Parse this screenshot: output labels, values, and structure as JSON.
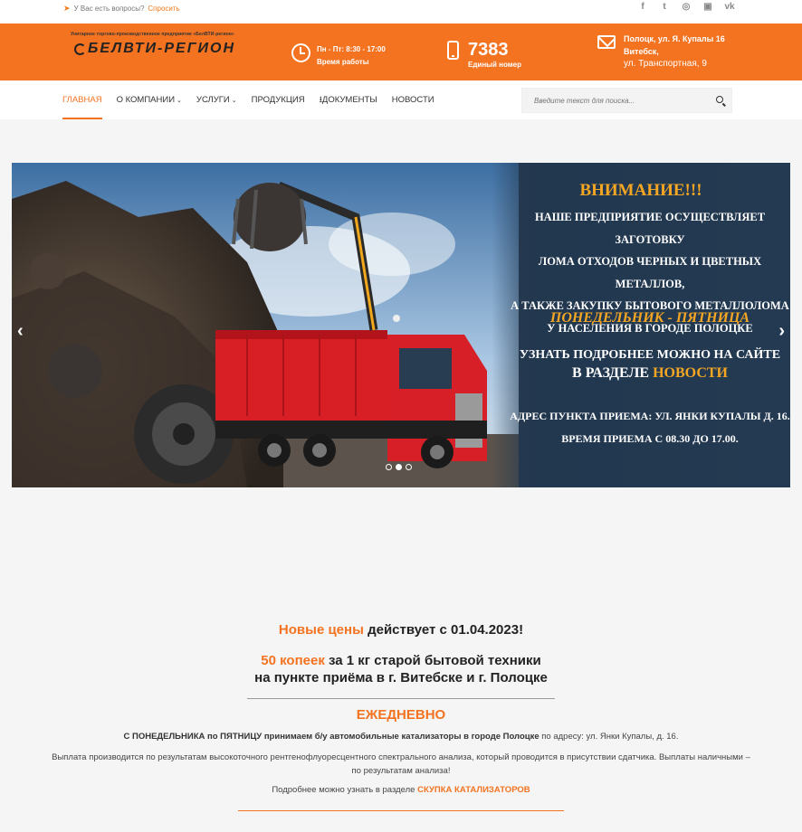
{
  "topbar": {
    "question": "У Вас есть вопросы?",
    "ask_link": "Спросить",
    "social": [
      "facebook-icon",
      "twitter-icon",
      "dribbble-icon",
      "instagram-icon",
      "vk-icon"
    ]
  },
  "header": {
    "logo_subtitle": "Унитарное торгово-производственное предприятие «БелВТИ-регион»",
    "logo_text": "БЕЛВТИ-РЕГИОН",
    "hours_line1": "Пн - Пт: 8:30 - 17:00",
    "hours_line2": "Время работы",
    "phone_number": "7383",
    "phone_label": "Единый номер",
    "address_line1": "Полоцк, ул. Я. Купалы 16",
    "address_line2": "Витебск,",
    "address_line3": "ул. Транспортная, 9"
  },
  "nav": {
    "items": [
      "ГЛАВНАЯ",
      "О КОМПАНИИ",
      "УСЛУГИ",
      "ПРОДУКЦИЯ",
      "ДОКУМЕНТЫ",
      "НОВОСТИ"
    ],
    "search_placeholder": "Введите текст для поиска..."
  },
  "slider": {
    "title": "ВНИМАНИЕ!!!",
    "body_lines": [
      "НАШЕ ПРЕДПРИЯТИЕ ОСУЩЕСТВЛЯЕТ ЗАГОТОВКУ",
      "ЛОМА ОТХОДОВ ЧЕРНЫХ И ЦВЕТНЫХ МЕТАЛЛОВ,",
      "А ТАКЖЕ ЗАКУПКУ БЫТОВОГО МЕТАЛЛОЛОМА",
      "У НАСЕЛЕНИЯ В ГОРОДЕ ПОЛОЦКЕ"
    ],
    "days": "ПОНЕДЕЛЬНИК - ПЯТНИЦА",
    "more_line1": "УЗНАТЬ ПОДРОБНЕЕ МОЖНО НА САЙТЕ",
    "more_line2_prefix": "В РАЗДЕЛЕ",
    "more_line2_link": "НОВОСТИ",
    "address_line": "АДРЕС ПУНКТА ПРИЕМА: УЛ. ЯНКИ КУПАЛЫ Д. 16.",
    "time_line": "ВРЕМЯ ПРИЕМА С 08.30 ДО 17.00.",
    "dots": 3,
    "active_dot": 2
  },
  "content": {
    "prices_highlight": "Новые цены",
    "prices_rest": " действует с 01.04.2023!",
    "offer_highlight": "50 копеек",
    "offer_rest": " за 1 кг старой бытовой техники",
    "offer_line2": "на пункте приёма в г. Витебске и г. Полоцке",
    "daily": "ЕЖЕДНЕВНО",
    "p1_bold": "С ПОНЕДЕЛЬНИКА по ПЯТНИЦУ принимаем б/у автомобильные катализаторы в городе Полоцке",
    "p1_rest": " по адресу: ул. Янки Купалы, д. 16.",
    "p2_line1": "Выплата производится по результатам высокоточного рентгенофлуоресцентного спектрального анализа, который проводится в присутствии сдатчика. Выплаты наличными –",
    "p2_line2": "по результатам анализа!",
    "p3_text": "Подробнее можно узнать в разделе ",
    "p3_link": "СКУПКА КАТАЛИЗАТОРОВ"
  }
}
